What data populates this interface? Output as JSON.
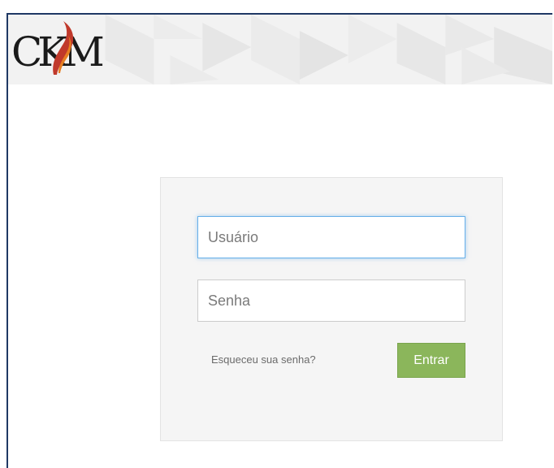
{
  "brand": {
    "logo_text": "CKM",
    "accent_color": "#c0392b"
  },
  "login": {
    "username_placeholder": "Usuário",
    "password_placeholder": "Senha",
    "forgot_password_label": "Esqueceu sua senha?",
    "submit_label": "Entrar",
    "submit_color": "#8bb65b",
    "focus_color": "#66afe9"
  }
}
